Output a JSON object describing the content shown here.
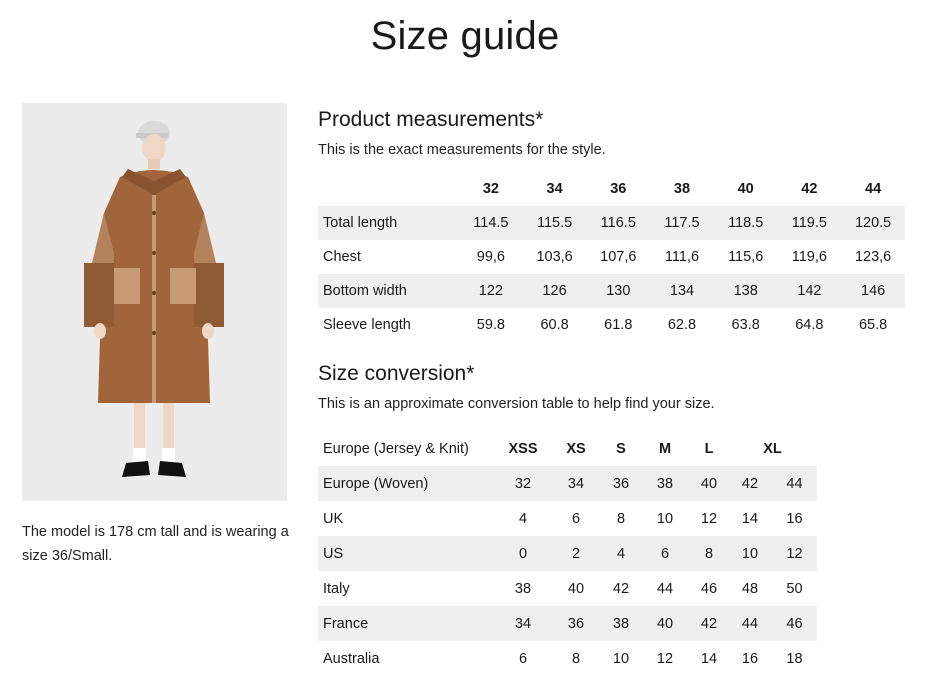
{
  "page": {
    "title": "Size guide"
  },
  "photo": {
    "alt": ""
  },
  "model_note": "The model is 178 cm tall and is wearing a size 36/Small.",
  "measurements": {
    "title": "Product measurements*",
    "subtitle": "This is the exact measurements for the style.",
    "sizes": [
      "32",
      "34",
      "36",
      "38",
      "40",
      "42",
      "44"
    ],
    "rows": [
      {
        "label": "Total length",
        "values": [
          "114.5",
          "115.5",
          "116.5",
          "117.5",
          "118.5",
          "119.5",
          "120.5"
        ]
      },
      {
        "label": "Chest",
        "values": [
          "99,6",
          "103,6",
          "107,6",
          "111,6",
          "115,6",
          "119,6",
          "123,6"
        ]
      },
      {
        "label": "Bottom width",
        "values": [
          "122",
          "126",
          "130",
          "134",
          "138",
          "142",
          "146"
        ]
      },
      {
        "label": "Sleeve length",
        "values": [
          "59.8",
          "60.8",
          "61.8",
          "62.8",
          "63.8",
          "64.8",
          "65.8"
        ]
      }
    ]
  },
  "conversion": {
    "title": "Size conversion*",
    "subtitle": "This is an approximate conversion table to help find your size.",
    "header_label": "Europe (Jersey & Knit)",
    "header_sizes": [
      "XSS",
      "XS",
      "S",
      "M",
      "L",
      "XL"
    ],
    "rows": [
      {
        "label": "Europe (Woven)",
        "values": [
          "32",
          "34",
          "36",
          "38",
          "40",
          "42",
          "44"
        ]
      },
      {
        "label": "UK",
        "values": [
          "4",
          "6",
          "8",
          "10",
          "12",
          "14",
          "16"
        ]
      },
      {
        "label": "US",
        "values": [
          "0",
          "2",
          "4",
          "6",
          "8",
          "10",
          "12"
        ]
      },
      {
        "label": "Italy",
        "values": [
          "38",
          "40",
          "42",
          "44",
          "46",
          "48",
          "50"
        ]
      },
      {
        "label": "France",
        "values": [
          "34",
          "36",
          "38",
          "40",
          "42",
          "44",
          "46"
        ]
      },
      {
        "label": "Australia",
        "values": [
          "6",
          "8",
          "10",
          "12",
          "14",
          "16",
          "18"
        ]
      }
    ]
  }
}
